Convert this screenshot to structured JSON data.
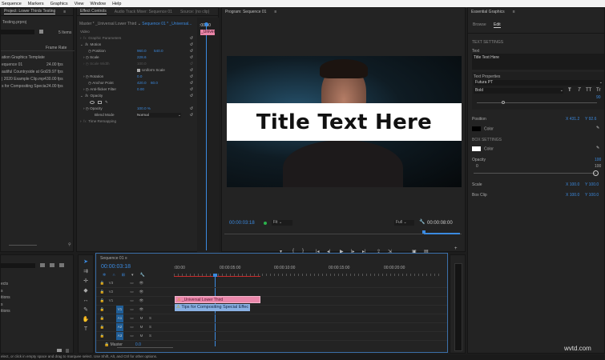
{
  "menu": [
    "Sequence",
    "Markers",
    "Graphics",
    "View",
    "Window",
    "Help"
  ],
  "project": {
    "title": "Project: Lower Thirds Testing",
    "file": "Testing.prproj",
    "items_count": "5 Items",
    "column": "Frame Rate",
    "rows": [
      {
        "name": "ation Graphics Template",
        "rate": ""
      },
      {
        "name": "equence 01",
        "rate": "24.00 fps"
      },
      {
        "name": "autiful Countryside at Gol",
        "rate": "29.97 fps"
      },
      {
        "name": "| 2020 Example Clip.mp4",
        "rate": "30.00 fps"
      },
      {
        "name": "s for Compositing Specia",
        "rate": "24.00 fps"
      }
    ]
  },
  "effects_panel": {
    "rows": [
      "ects",
      "s",
      "itions",
      "s",
      "itions"
    ]
  },
  "effect_controls": {
    "tabs": [
      "Effect Controls",
      "Audio Track Mixer: Sequence 01",
      "Source: (no clip)"
    ],
    "master": "Master * _Universal Lower Third",
    "sequence": "Sequence 01 * _Universal...",
    "mini_time": ":00:00",
    "clip_label": "_Univer",
    "video_label": "Video",
    "graphic_parameters": "Graphic Parameters",
    "motion": "Motion",
    "position_label": "Position",
    "position_x": "960.0",
    "position_y": "540.0",
    "scale_label": "Scale",
    "scale": "228.6",
    "scale_width_label": "Scale Width",
    "scale_width": "100.0",
    "uniform_scale": "Uniform Scale",
    "rotation_label": "Rotation",
    "rotation": "0.0",
    "anchor_label": "Anchor Point",
    "anchor_x": "420.0",
    "anchor_y": "60.0",
    "antiflicker_label": "Anti-flicker Filter",
    "antiflicker": "0.00",
    "opacity_section": "Opacity",
    "opacity_label": "Opacity",
    "opacity": "100.0 %",
    "blend_label": "Blend Mode",
    "blend": "Normal",
    "time_remap": "Time Remapping"
  },
  "program": {
    "title": "Program: Sequence 01",
    "overlay_text": "Title Text Here",
    "timecode": "00:00:03:18",
    "fit": "Fit",
    "quality": "Full",
    "duration": "00:00:08:00"
  },
  "essential_graphics": {
    "title": "Essential Graphics",
    "tabs": [
      "Browse",
      "Edit"
    ],
    "text_settings": "TEXT SETTINGS",
    "text_label": "Text",
    "text_value": "Title Text Here",
    "text_properties": "Text Properties",
    "font": "Futura PT",
    "style": "Bold",
    "font_size": "90",
    "style_buttons": [
      "T",
      "T",
      "TT",
      "Tr"
    ],
    "position_label": "Position",
    "pos_x": "X 431.2",
    "pos_y": "Y 92.6",
    "color_label": "Color",
    "text_color": "#000000",
    "box_settings": "BOX SETTINGS",
    "box_color_label": "Color",
    "box_color": "#ffffff",
    "opacity_label": "Opacity",
    "opacity_value": "100",
    "opacity_min": "0",
    "opacity_max": "100",
    "opacity_fraction": 1.0,
    "scale_label": "Scale",
    "scale_x": "X 100.0",
    "scale_y": "Y 100.0",
    "boxclip_label": "Box Clip",
    "boxclip_x": "X 100.0",
    "boxclip_y": "Y 100.0"
  },
  "timeline": {
    "title": "Sequence 01",
    "timecode": "00:00:03:18",
    "ruler": [
      ":00:00",
      "00:00:05:00",
      "00:00:10:00",
      "00:00:15:00",
      "00:00:20:00"
    ],
    "video_tracks": [
      "V3",
      "V2",
      "V1"
    ],
    "extra_track": "V1",
    "audio_tracks": [
      "A1",
      "A2",
      "A3"
    ],
    "master_label": "Master",
    "master_value": "0.0",
    "clip_pink": "_Universal Lower Third",
    "clip_blue": "Tips for Compositing Special Effec",
    "m": "M",
    "s": "S"
  },
  "status": "elect, or click in empty space and drag to marquee select. Use Shift, Alt, and Ctrl for other options.",
  "watermark": "wvtd.com"
}
